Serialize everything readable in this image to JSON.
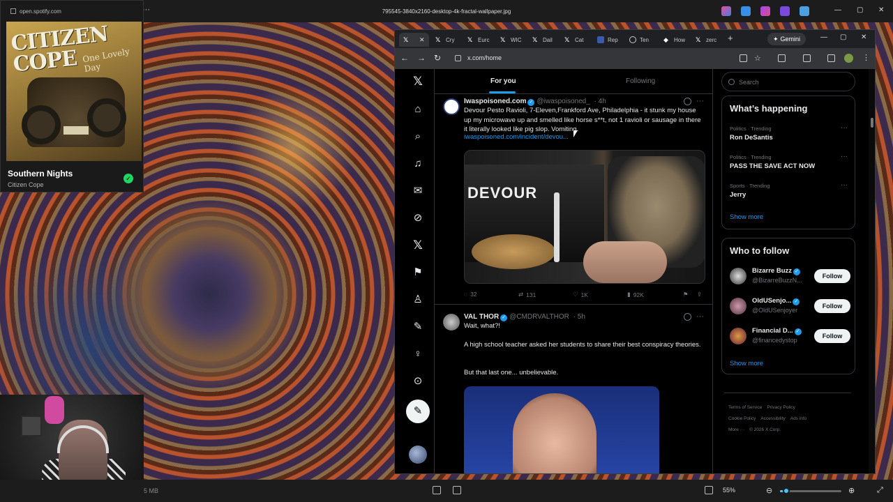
{
  "viewer": {
    "title": "795545-3840x2160-desktop-4k-fractal-wallpaper.jpg",
    "file_size": "5 MB",
    "zoom": "55%",
    "zoom_fraction": 0.1
  },
  "spotify": {
    "url": "open.spotify.com",
    "album_art_title": "CITIZEN COPE",
    "album_art_subtitle": "One Lovely Day",
    "song": "Southern Nights",
    "artist": "Citizen Cope"
  },
  "browser": {
    "tabs": [
      {
        "icon": "x-icon",
        "label": ""
      },
      {
        "icon": "x-icon",
        "label": "Cry"
      },
      {
        "icon": "x-icon",
        "label": "Eurc"
      },
      {
        "icon": "x-icon",
        "label": "WIC"
      },
      {
        "icon": "x-icon",
        "label": "Dail"
      },
      {
        "icon": "x-icon",
        "label": "Cat"
      },
      {
        "icon": "news-icon",
        "label": "Rep"
      },
      {
        "icon": "globe-icon",
        "label": "Ten"
      },
      {
        "icon": "diamond-icon",
        "label": "How"
      },
      {
        "icon": "x-icon",
        "label": "zerc"
      }
    ],
    "gemini_label": "Gemini",
    "url": "x.com/home"
  },
  "x": {
    "feed_tabs": [
      "For you",
      "Following"
    ],
    "posts": [
      {
        "name": "Iwaspoisoned.com",
        "handle": "@iwaspoisoned_",
        "time": "· 4h",
        "text": "Devour Pesto Ravioli, 7-Eleven,Frankford Ave, Philadelphia - it stunk my house up my microwave up and smelled like horse s**t, not 1 ravioli or sausage in there it literally looked like pig slop. Vomiting.",
        "link": "iwaspoisoned.com/incident/devou...",
        "media_text": "DEVOUR",
        "replies": "32",
        "reposts": "131",
        "likes": "1K",
        "views": "92K"
      },
      {
        "name": "VAL THOR",
        "handle": "@CMDRVALTHOR",
        "time": "· 5h",
        "text_lines": [
          "Wait, what?!",
          "A high school teacher asked her students to share their best conspiracy theories.",
          "But that last one... unbelievable."
        ]
      }
    ],
    "search_placeholder": "Search",
    "whats_happening": {
      "title": "What’s happening",
      "trends": [
        {
          "meta": "Politics · Trending",
          "name": "Ron DeSantis"
        },
        {
          "meta": "Politics · Trending",
          "name": "PASS THE SAVE ACT NOW"
        },
        {
          "meta": "Sports · Trending",
          "name": "Jerry"
        }
      ],
      "show_more": "Show more"
    },
    "who_to_follow": {
      "title": "Who to follow",
      "accounts": [
        {
          "name": "Bizarre Buzz",
          "handle": "@BizarreBuzzN..."
        },
        {
          "name": "OldUSenjo...",
          "handle": "@OldUSenjoyer"
        },
        {
          "name": "Financial D...",
          "handle": "@financedystop"
        }
      ],
      "follow_label": "Follow",
      "show_more": "Show more"
    },
    "footer": [
      "Terms of Service",
      "Privacy Policy",
      "Cookie Policy",
      "Accessibility",
      "Ads info",
      "More ···",
      "© 2026 X Corp."
    ]
  }
}
